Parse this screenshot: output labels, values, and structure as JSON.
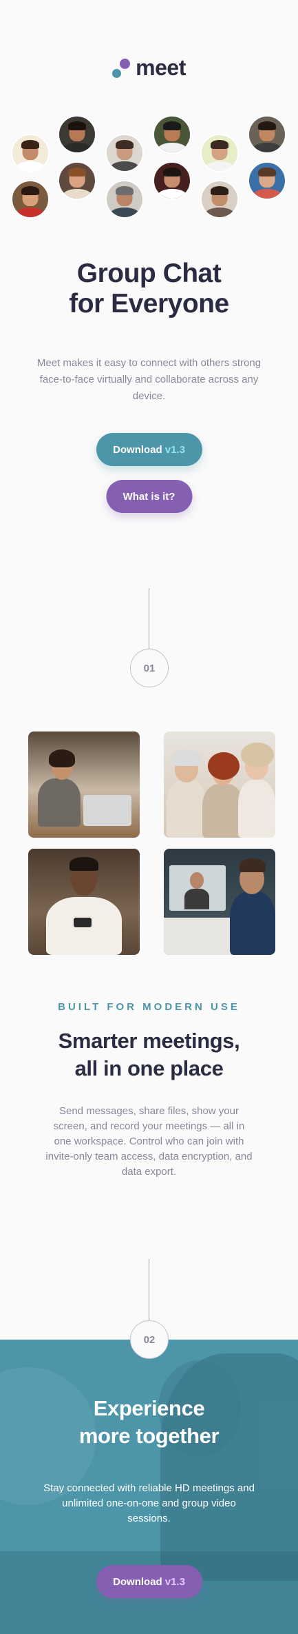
{
  "brand": {
    "name": "meet"
  },
  "hero": {
    "title_line1": "Group Chat",
    "title_line2": "for Everyone",
    "text": "Meet makes it easy to connect with others strong face-to-face virtually and collaborate across any device.",
    "download_label": "Download",
    "download_version": "v1.3",
    "whatis_label": "What is it?"
  },
  "section1": {
    "number": "01",
    "eyebrow": "BUILT FOR MODERN USE",
    "title_line1": "Smarter meetings,",
    "title_line2": "all in one place",
    "text": "Send messages, share files, show your screen, and record your meetings — all in one workspace. Control who can join with invite-only team access, data encryption, and data export."
  },
  "section2": {
    "number": "02",
    "title_line1": "Experience",
    "title_line2": "more together",
    "text": "Stay connected with reliable HD meetings and unlimited one-on-one and group video sessions.",
    "download_label": "Download",
    "download_version": "v1.3"
  },
  "colors": {
    "teal": "#4d96a9",
    "purple": "#855fb1",
    "dark": "#2b2c41",
    "gray": "#87899a"
  }
}
